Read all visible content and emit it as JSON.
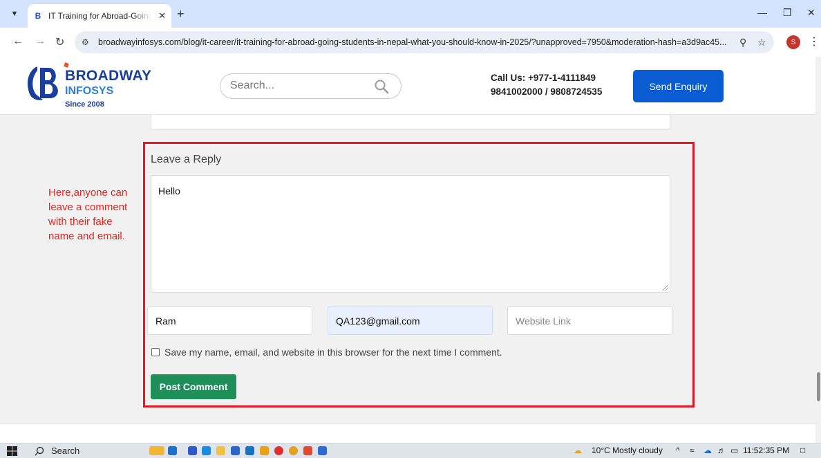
{
  "browser": {
    "tab_title": "IT Training for Abroad-Going St",
    "url": "broadwayinfosys.com/blog/it-career/it-training-for-abroad-going-students-in-nepal-what-you-should-know-in-2025/?unapproved=7950&moderation-hash=a3d9ac45...",
    "profile_initial": "S"
  },
  "header": {
    "logo_name": "BROADWAY",
    "logo_sub": "INFOSYS",
    "logo_since": "Since 2008",
    "search_placeholder": "Search...",
    "call_us": "Call Us: +977-1-4111849",
    "phones": "9841002000 / 9808724535",
    "enquiry_label": "Send Enquiry"
  },
  "annotation": {
    "text": "Here,anyone can leave a comment with their fake name and email.",
    "color": "#e3241f"
  },
  "reply_form": {
    "title": "Leave a Reply",
    "comment_value": "Hello",
    "name_value": "Ram",
    "email_value": "QA123@gmail.com",
    "website_placeholder": "Website Link",
    "save_label": "Save my name, email, and website in this browser for the next time I comment.",
    "submit_label": "Post Comment",
    "submit_color": "#1f8f5a"
  },
  "taskbar": {
    "search_label": "Search",
    "weather": "10°C  Mostly cloudy",
    "time": "11:52:35 PM"
  }
}
